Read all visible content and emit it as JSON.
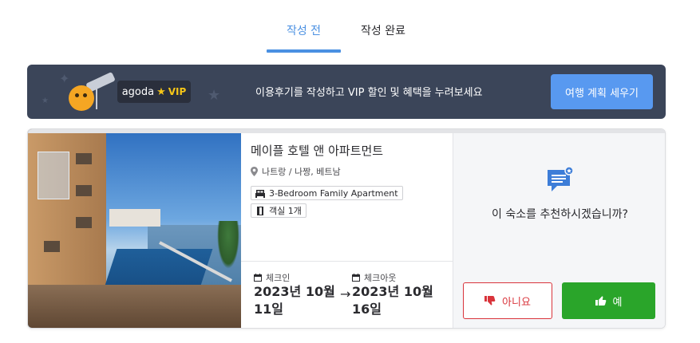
{
  "tabs": [
    {
      "label": "작성 전",
      "active": true
    },
    {
      "label": "작성 완료",
      "active": false
    }
  ],
  "banner": {
    "brand": "agoda",
    "vip_label": "VIP",
    "message": "이용후기를 작성하고 VIP 할인 및 혜택을 누려보세요",
    "cta_label": "여행 계획 세우기"
  },
  "booking": {
    "hotel_name": "메이플 호텔 앤 아파트먼트",
    "location": "나트랑 / 나짱, 베트남",
    "room_type": "3-Bedroom Family Apartment",
    "room_count": "객실 1개",
    "checkin_label": "체크인",
    "checkin_date": "2023년 10월 11일",
    "checkout_label": "체크아웃",
    "checkout_date": "2023년 10월 16일"
  },
  "recommend": {
    "question": "이 숙소를 추천하시겠습니까?",
    "no_label": "아니요",
    "yes_label": "예"
  },
  "colors": {
    "accent": "#4a90e2",
    "banner_bg": "#3b4559",
    "cta_bg": "#5899f0",
    "no_red": "#d9343b",
    "yes_green": "#2aa52a",
    "vip_gold": "#f5c518"
  }
}
